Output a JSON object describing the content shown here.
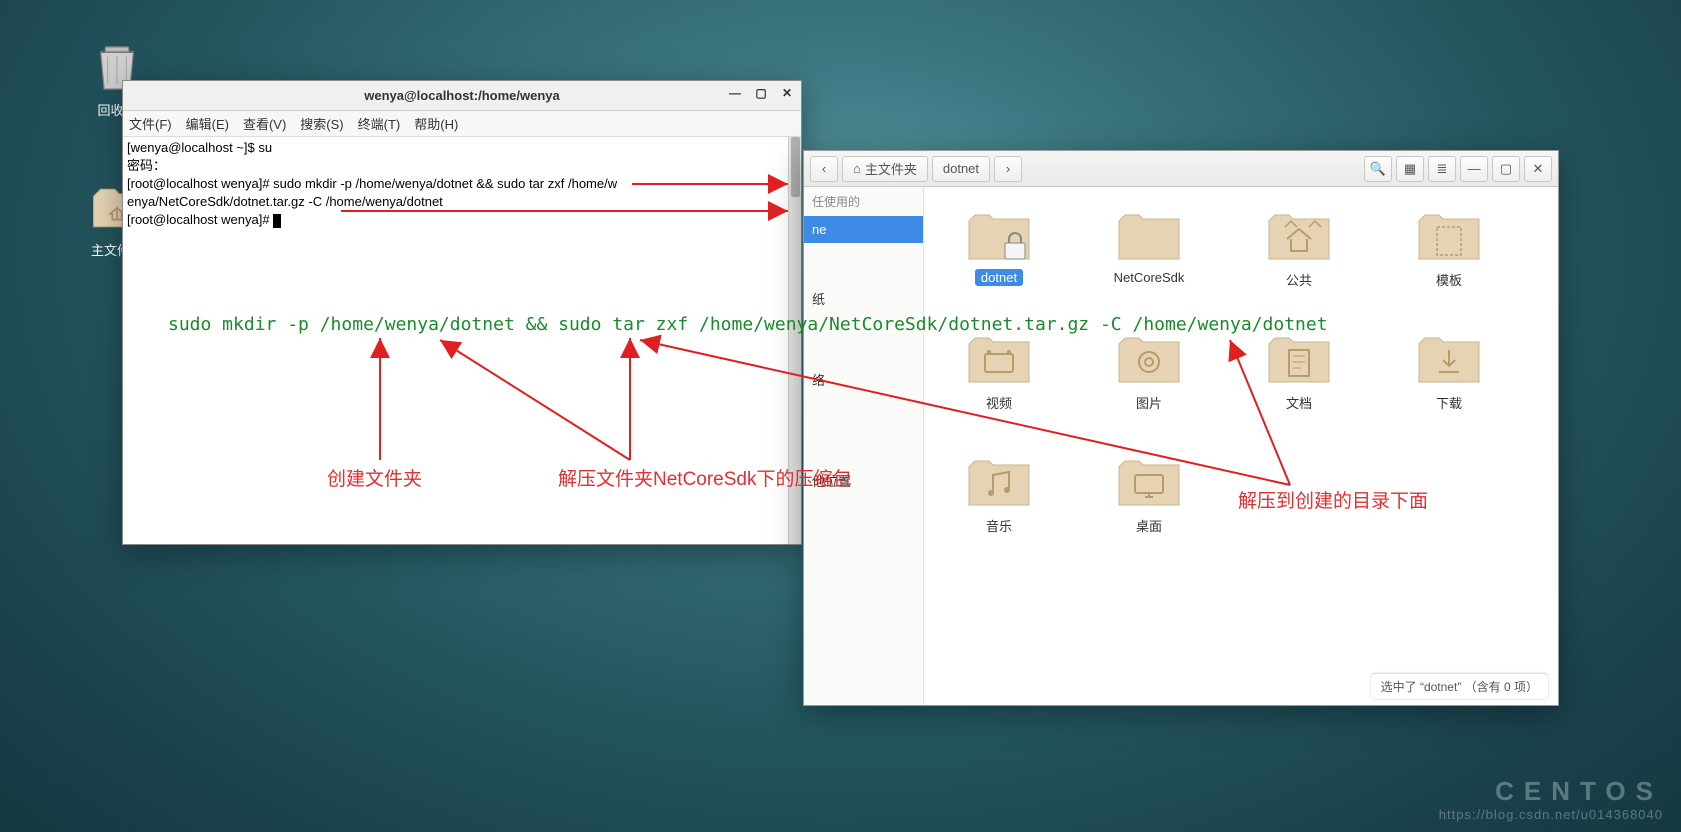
{
  "desktop": {
    "trash": "回收站",
    "home": "主文件夹"
  },
  "terminal": {
    "title": "wenya@localhost:/home/wenya",
    "menus": [
      "文件(F)",
      "编辑(E)",
      "查看(V)",
      "搜索(S)",
      "终端(T)",
      "帮助(H)"
    ],
    "lines": [
      "[wenya@localhost ~]$ su",
      "密码：",
      "[root@localhost wenya]# sudo mkdir -p /home/wenya/dotnet && sudo tar zxf /home/w",
      "enya/NetCoreSdk/dotnet.tar.gz -C /home/wenya/dotnet",
      "[root@localhost wenya]# "
    ]
  },
  "filemanager": {
    "crumb_home": "主文件夹",
    "crumb_item": "dotnet",
    "side": {
      "recent": "任使用的",
      "home": "ne",
      "trash": "纸",
      "network": "络",
      "other": "他位置"
    },
    "folders": [
      {
        "name": "dotnet",
        "type": "locked",
        "selected": true
      },
      {
        "name": "NetCoreSdk",
        "type": "plain"
      },
      {
        "name": "公共",
        "type": "public"
      },
      {
        "name": "模板",
        "type": "template"
      },
      {
        "name": "视频",
        "type": "video"
      },
      {
        "name": "图片",
        "type": "picture"
      },
      {
        "name": "文档",
        "type": "document"
      },
      {
        "name": "下载",
        "type": "download"
      },
      {
        "name": "音乐",
        "type": "music"
      },
      {
        "name": "桌面",
        "type": "desktop"
      }
    ],
    "status": "选中了 “dotnet” （含有 0 项）"
  },
  "annotations": {
    "command": "sudo mkdir -p /home/wenya/dotnet && sudo tar zxf /home/wenya/NetCoreSdk/dotnet.tar.gz -C /home/wenya/dotnet",
    "label1": "创建文件夹",
    "label2": "解压文件夹NetCoreSdk下的压缩包",
    "label3": "解压到创建的目录下面"
  },
  "watermark": {
    "brand": "CENTOS",
    "url": "https://blog.csdn.net/u014368040"
  }
}
